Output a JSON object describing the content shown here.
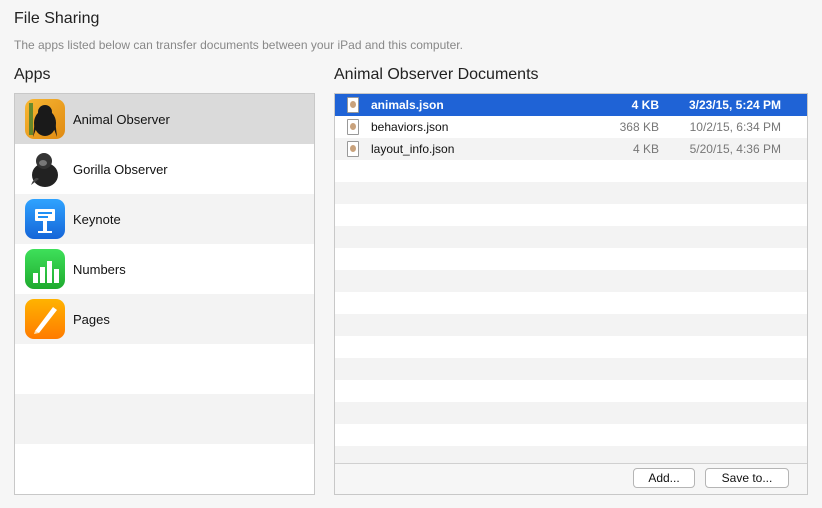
{
  "header": {
    "title": "File Sharing",
    "subtitle": "The apps listed below can transfer documents between your iPad and this computer."
  },
  "apps": {
    "heading": "Apps",
    "items": [
      {
        "name": "Animal Observer",
        "icon": "animal-observer-app-icon",
        "selected": true
      },
      {
        "name": "Gorilla Observer",
        "icon": "gorilla-observer-app-icon",
        "selected": false
      },
      {
        "name": "Keynote",
        "icon": "keynote-app-icon",
        "selected": false
      },
      {
        "name": "Numbers",
        "icon": "numbers-app-icon",
        "selected": false
      },
      {
        "name": "Pages",
        "icon": "pages-app-icon",
        "selected": false
      }
    ]
  },
  "documents": {
    "heading": "Animal Observer Documents",
    "items": [
      {
        "name": "animals.json",
        "size": "4 KB",
        "date": "3/23/15, 5:24 PM",
        "selected": true
      },
      {
        "name": "behaviors.json",
        "size": "368 KB",
        "date": "10/2/15, 6:34 PM",
        "selected": false
      },
      {
        "name": "layout_info.json",
        "size": "4 KB",
        "date": "5/20/15, 4:36 PM",
        "selected": false
      }
    ],
    "add_label": "Add...",
    "save_label": "Save to..."
  },
  "colors": {
    "selection_blue": "#1f63d6",
    "selected_app_gray": "#dadada",
    "keynote_blue": "#1f8ff5",
    "numbers_green": "#2bc73c",
    "pages_orange": "#ff9800"
  }
}
